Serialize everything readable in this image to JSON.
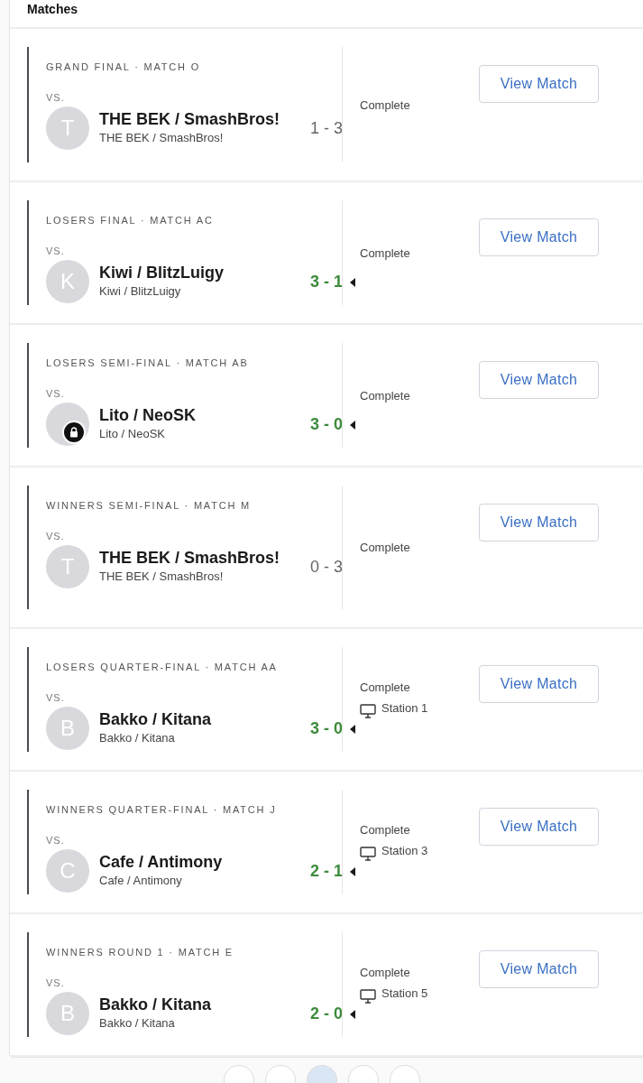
{
  "section_title": "Matches",
  "matches": [
    {
      "round": "GRAND FINAL · MATCH O",
      "vs": "VS.",
      "initial": "T",
      "name": "THE BEK / SmashBros!",
      "subname": "THE BEK / SmashBros!",
      "score": "1 - 3",
      "won": false,
      "status": "Complete",
      "button": "View Match"
    },
    {
      "round": "LOSERS FINAL · MATCH AC",
      "vs": "VS.",
      "initial": "K",
      "name": "Kiwi / BlitzLuigy",
      "subname": "Kiwi / BlitzLuigy",
      "score": "3 - 1",
      "won": true,
      "status": "Complete",
      "button": "View Match"
    },
    {
      "round": "LOSERS SEMI-FINAL · MATCH AB",
      "vs": "VS.",
      "locked": true,
      "name": "Lito / NeoSK",
      "subname": "Lito / NeoSK",
      "score": "3 - 0",
      "won": true,
      "status": "Complete",
      "button": "View Match"
    },
    {
      "round": "WINNERS SEMI-FINAL · MATCH M",
      "vs": "VS.",
      "initial": "T",
      "name": "THE BEK / SmashBros!",
      "subname": "THE BEK / SmashBros!",
      "score": "0 - 3",
      "won": false,
      "status": "Complete",
      "button": "View Match"
    },
    {
      "round": "LOSERS QUARTER-FINAL · MATCH AA",
      "vs": "VS.",
      "initial": "B",
      "name": "Bakko / Kitana",
      "subname": "Bakko / Kitana",
      "score": "3 - 0",
      "won": true,
      "status": "Complete",
      "station": "Station 1",
      "button": "View Match"
    },
    {
      "round": "WINNERS QUARTER-FINAL · MATCH J",
      "vs": "VS.",
      "initial": "C",
      "name": "Cafe / Antimony",
      "subname": "Cafe / Antimony",
      "score": "2 - 1",
      "won": true,
      "status": "Complete",
      "station": "Station 3",
      "button": "View Match"
    },
    {
      "round": "WINNERS ROUND 1 · MATCH E",
      "vs": "VS.",
      "initial": "B",
      "name": "Bakko / Kitana",
      "subname": "Bakko / Kitana",
      "score": "2 - 0",
      "won": true,
      "status": "Complete",
      "station": "Station 5",
      "button": "View Match"
    }
  ],
  "pagination": [
    {
      "selected": false
    },
    {
      "selected": false
    },
    {
      "selected": true
    },
    {
      "selected": false
    },
    {
      "selected": false
    }
  ]
}
